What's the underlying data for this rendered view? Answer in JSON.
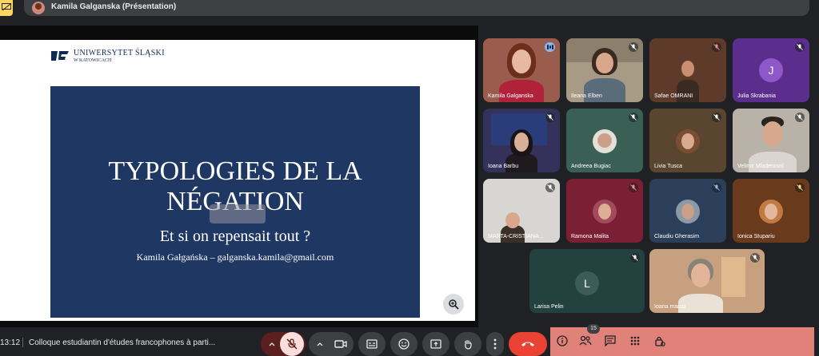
{
  "presenter": {
    "label": "Kamila Galganska (Présentation)"
  },
  "slide": {
    "university_name": "UNIWERSYTET ŚLĄSKI",
    "university_city": "W KATOWICACH",
    "title_line1": "TYPOLOGIES DE LA",
    "title_line2": "NÉGATION",
    "subtitle": "Et si on repensait tout ?",
    "author": "Kamila Gałgańska – galganska.kamila@gmail.com"
  },
  "participants": [
    {
      "name": "Kamila Galganska",
      "state": "speaking"
    },
    {
      "name": "Ileana Elben",
      "state": "muted"
    },
    {
      "name": "Safae OMRANI",
      "state": "muted"
    },
    {
      "name": "Julia Skrabania",
      "state": "muted",
      "initial": "J"
    },
    {
      "name": "Ioana Barbu",
      "state": "muted"
    },
    {
      "name": "Andreea Bugiac",
      "state": "muted"
    },
    {
      "name": "Livia Tusca",
      "state": "muted"
    },
    {
      "name": "Velimir Mladenović",
      "state": "muted"
    },
    {
      "name": "MARTA-CRISTIANA...",
      "state": "muted"
    },
    {
      "name": "Ramona Malita",
      "state": "muted"
    },
    {
      "name": "Claudiu Gherasim",
      "state": "muted"
    },
    {
      "name": "Ionica Stupariu",
      "state": "muted"
    },
    {
      "name": "Larisa Pelin",
      "state": "muted",
      "initial": "L"
    },
    {
      "name": "Ioana marcu",
      "state": "muted"
    }
  ],
  "bottom": {
    "time": "13:12",
    "meeting_title": "Colloque estudiantin d'études francophones à parti...",
    "participant_count": "15"
  },
  "colors": {
    "slide_panel": "#1f3763",
    "end_call": "#ea4335",
    "mic_off": "#f28b82",
    "present_icon": "#fdd663"
  }
}
